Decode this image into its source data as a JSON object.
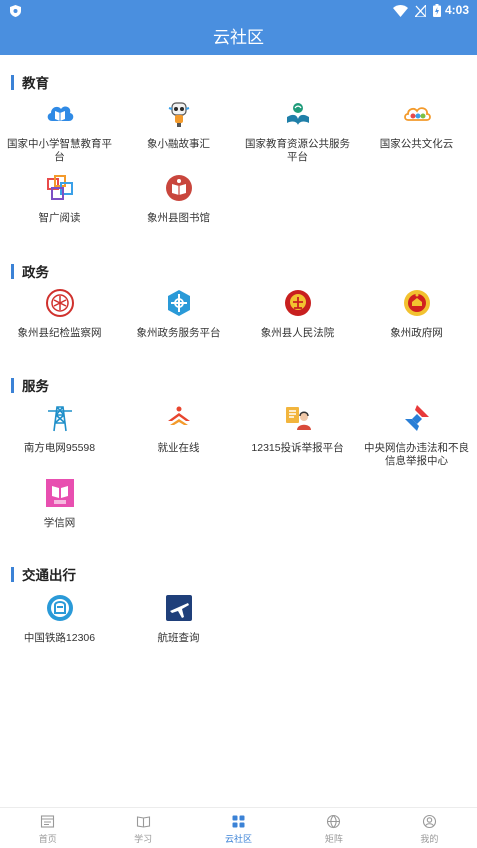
{
  "status_bar": {
    "time": "4:03"
  },
  "header": {
    "title": "云社区"
  },
  "sections": [
    {
      "title": "教育",
      "items": [
        {
          "label": "国家中小学智慧教育平台",
          "icon": "cloud-book-icon"
        },
        {
          "label": "象小融故事汇",
          "icon": "robot-mascot-icon"
        },
        {
          "label": "国家教育资源公共服务平台",
          "icon": "education-resource-icon"
        },
        {
          "label": "国家公共文化云",
          "icon": "culture-cloud-icon"
        },
        {
          "label": "智广阅读",
          "icon": "color-frames-icon"
        },
        {
          "label": "象州县图书馆",
          "icon": "library-icon"
        }
      ]
    },
    {
      "title": "政务",
      "items": [
        {
          "label": "象州县纪检监察网",
          "icon": "inspection-emblem-icon"
        },
        {
          "label": "象州政务服务平台",
          "icon": "government-service-icon"
        },
        {
          "label": "象州县人民法院",
          "icon": "court-emblem-icon"
        },
        {
          "label": "象州政府网",
          "icon": "national-emblem-icon"
        }
      ]
    },
    {
      "title": "服务",
      "items": [
        {
          "label": "南方电网95598",
          "icon": "power-tower-icon"
        },
        {
          "label": "就业在线",
          "icon": "employment-icon"
        },
        {
          "label": "12315投诉举报平台",
          "icon": "complaint-report-icon"
        },
        {
          "label": "中央网信办违法和不良信息举报中心",
          "icon": "report-center-icon"
        },
        {
          "label": "学信网",
          "icon": "xuexin-book-icon"
        }
      ]
    },
    {
      "title": "交通出行",
      "items": [
        {
          "label": "中国铁路12306",
          "icon": "railway-icon"
        },
        {
          "label": "航班查询",
          "icon": "flight-icon"
        }
      ]
    }
  ],
  "tabs": [
    {
      "label": "首页",
      "icon": "home-icon"
    },
    {
      "label": "学习",
      "icon": "book-icon"
    },
    {
      "label": "云社区",
      "icon": "grid-icon",
      "active": true
    },
    {
      "label": "矩阵",
      "icon": "globe-icon"
    },
    {
      "label": "我的",
      "icon": "user-icon"
    }
  ],
  "colors": {
    "accent": "#4a8fdf",
    "section_bar": "#3b82d6",
    "tab_active": "#3b82d6",
    "tab_inactive": "#999999"
  }
}
